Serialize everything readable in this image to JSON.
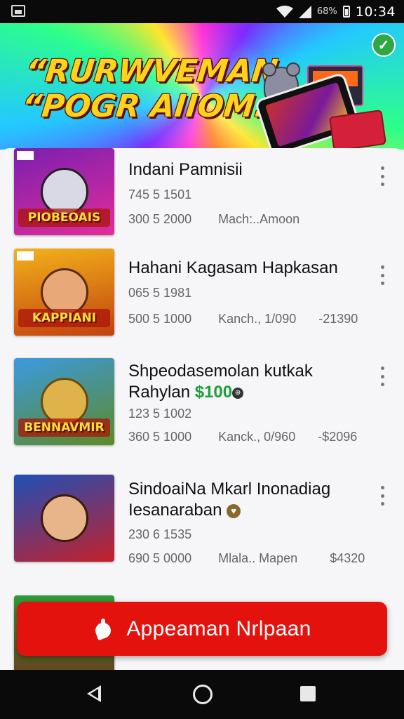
{
  "status_bar": {
    "time": "10:34",
    "battery_text": "68%",
    "icons": [
      "screenshot-icon",
      "wifi-icon",
      "signal-icon",
      "battery-icon"
    ]
  },
  "banner": {
    "title_line1": "“RURWVEMAN",
    "title_line2": "“POGR AIIOM.”"
  },
  "items": [
    {
      "title": "Indani Pamnisii",
      "line1": "745 5 1501",
      "line2_a": "300 5 2000",
      "line2_b": "Mach:..Amoon",
      "line2_c": "",
      "thumb_label": "PIOBEOAIS",
      "thumb_colors": [
        "#7a1fb0",
        "#e22d9a"
      ]
    },
    {
      "title": "Hahani Kagasam Hapkasan",
      "line1": "065 5 1981",
      "line2_a": "500 5 1000",
      "line2_b": "Kanch., 1/090",
      "line2_c": "-21390",
      "thumb_label": "KAPPIANI",
      "thumb_colors": [
        "#f2a51a",
        "#c2410f"
      ]
    },
    {
      "title_line1": "Shpeodasemolan kutkak",
      "title_line2_text": "Rahylan",
      "title_line2_price": "$100",
      "line1": "123 5 1002",
      "line2_a": "360 5 1000",
      "line2_b": "Kanck., 0/960",
      "line2_c": "-$2096",
      "thumb_label": "BENNAVMIR",
      "thumb_colors": [
        "#2f8fd6",
        "#6a8e2a"
      ]
    },
    {
      "title_line1": "SindoaiNa Mkarl Inonadiag",
      "title_line2_text": "Iesanaraban",
      "line1": "230 6 1535",
      "line2_a": "690 5 0000",
      "line2_b": "Mlala.. Mapen",
      "line2_c": "$4320",
      "thumb_label": "",
      "thumb_colors": [
        "#1e4fb8",
        "#c4202a"
      ]
    }
  ],
  "cta": {
    "label": "Appeaman Nrlpaan"
  }
}
